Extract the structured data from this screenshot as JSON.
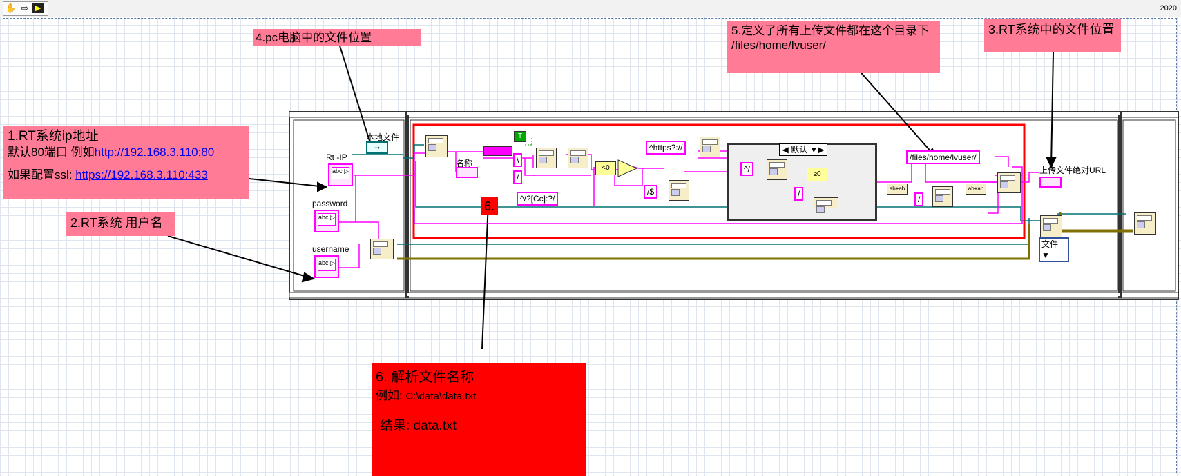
{
  "toolbar": {
    "run_icon": "hand-icon",
    "step_icon": "arrow-right-icon",
    "app_icon": "labview-icon",
    "version": "2020"
  },
  "notes": {
    "n1": {
      "title": "1.RT系统ip地址",
      "line2_prefix": "默认80端口 例如",
      "link1": "http://192.168.3.110:80",
      "line3_prefix": "如果配置ssl: ",
      "link2": "https://192.168.3.110:433"
    },
    "n2": "2.RT系统 用户名",
    "n3": "3.RT系统中的文件位置",
    "n4": "4.pc电脑中的文件位置",
    "n5": {
      "line1": "5.定义了所有上传文件都在这个目录下",
      "line2": "/files/home/lvuser/"
    },
    "n6_tag": "6.",
    "n6": {
      "title": "6.  解析文件名称",
      "line2_prefix": "例如: ",
      "line2_value": "C:\\data\\data.txt",
      "line3": "结果: data.txt"
    }
  },
  "labels": {
    "rt_ip": "Rt -IP",
    "password": "password",
    "username": "username",
    "local_file": "本地文件",
    "name": "名称",
    "upload_url": "上传文件绝对URL"
  },
  "constants": {
    "backslash": "\\",
    "slash": "/",
    "https_regex": "^https?://",
    "dollar": "/$",
    "drive_regex": "^/?[Cc]:?/",
    "caret_slash": "^/",
    "slash2": "/",
    "slash3": "/",
    "lvuser_path": "/files/home/lvuser/",
    "true_const": "T",
    "zero_lt": "<0",
    "zero_ge": "≥0"
  },
  "case": {
    "selector": "默认"
  },
  "ring": {
    "value": "文件"
  },
  "colors": {
    "note_pink": "#ff7b96",
    "note_red": "#ff0000",
    "string_wire": "#ff00ff",
    "refnum_wire": "#006060",
    "error_wire": "#807000"
  }
}
